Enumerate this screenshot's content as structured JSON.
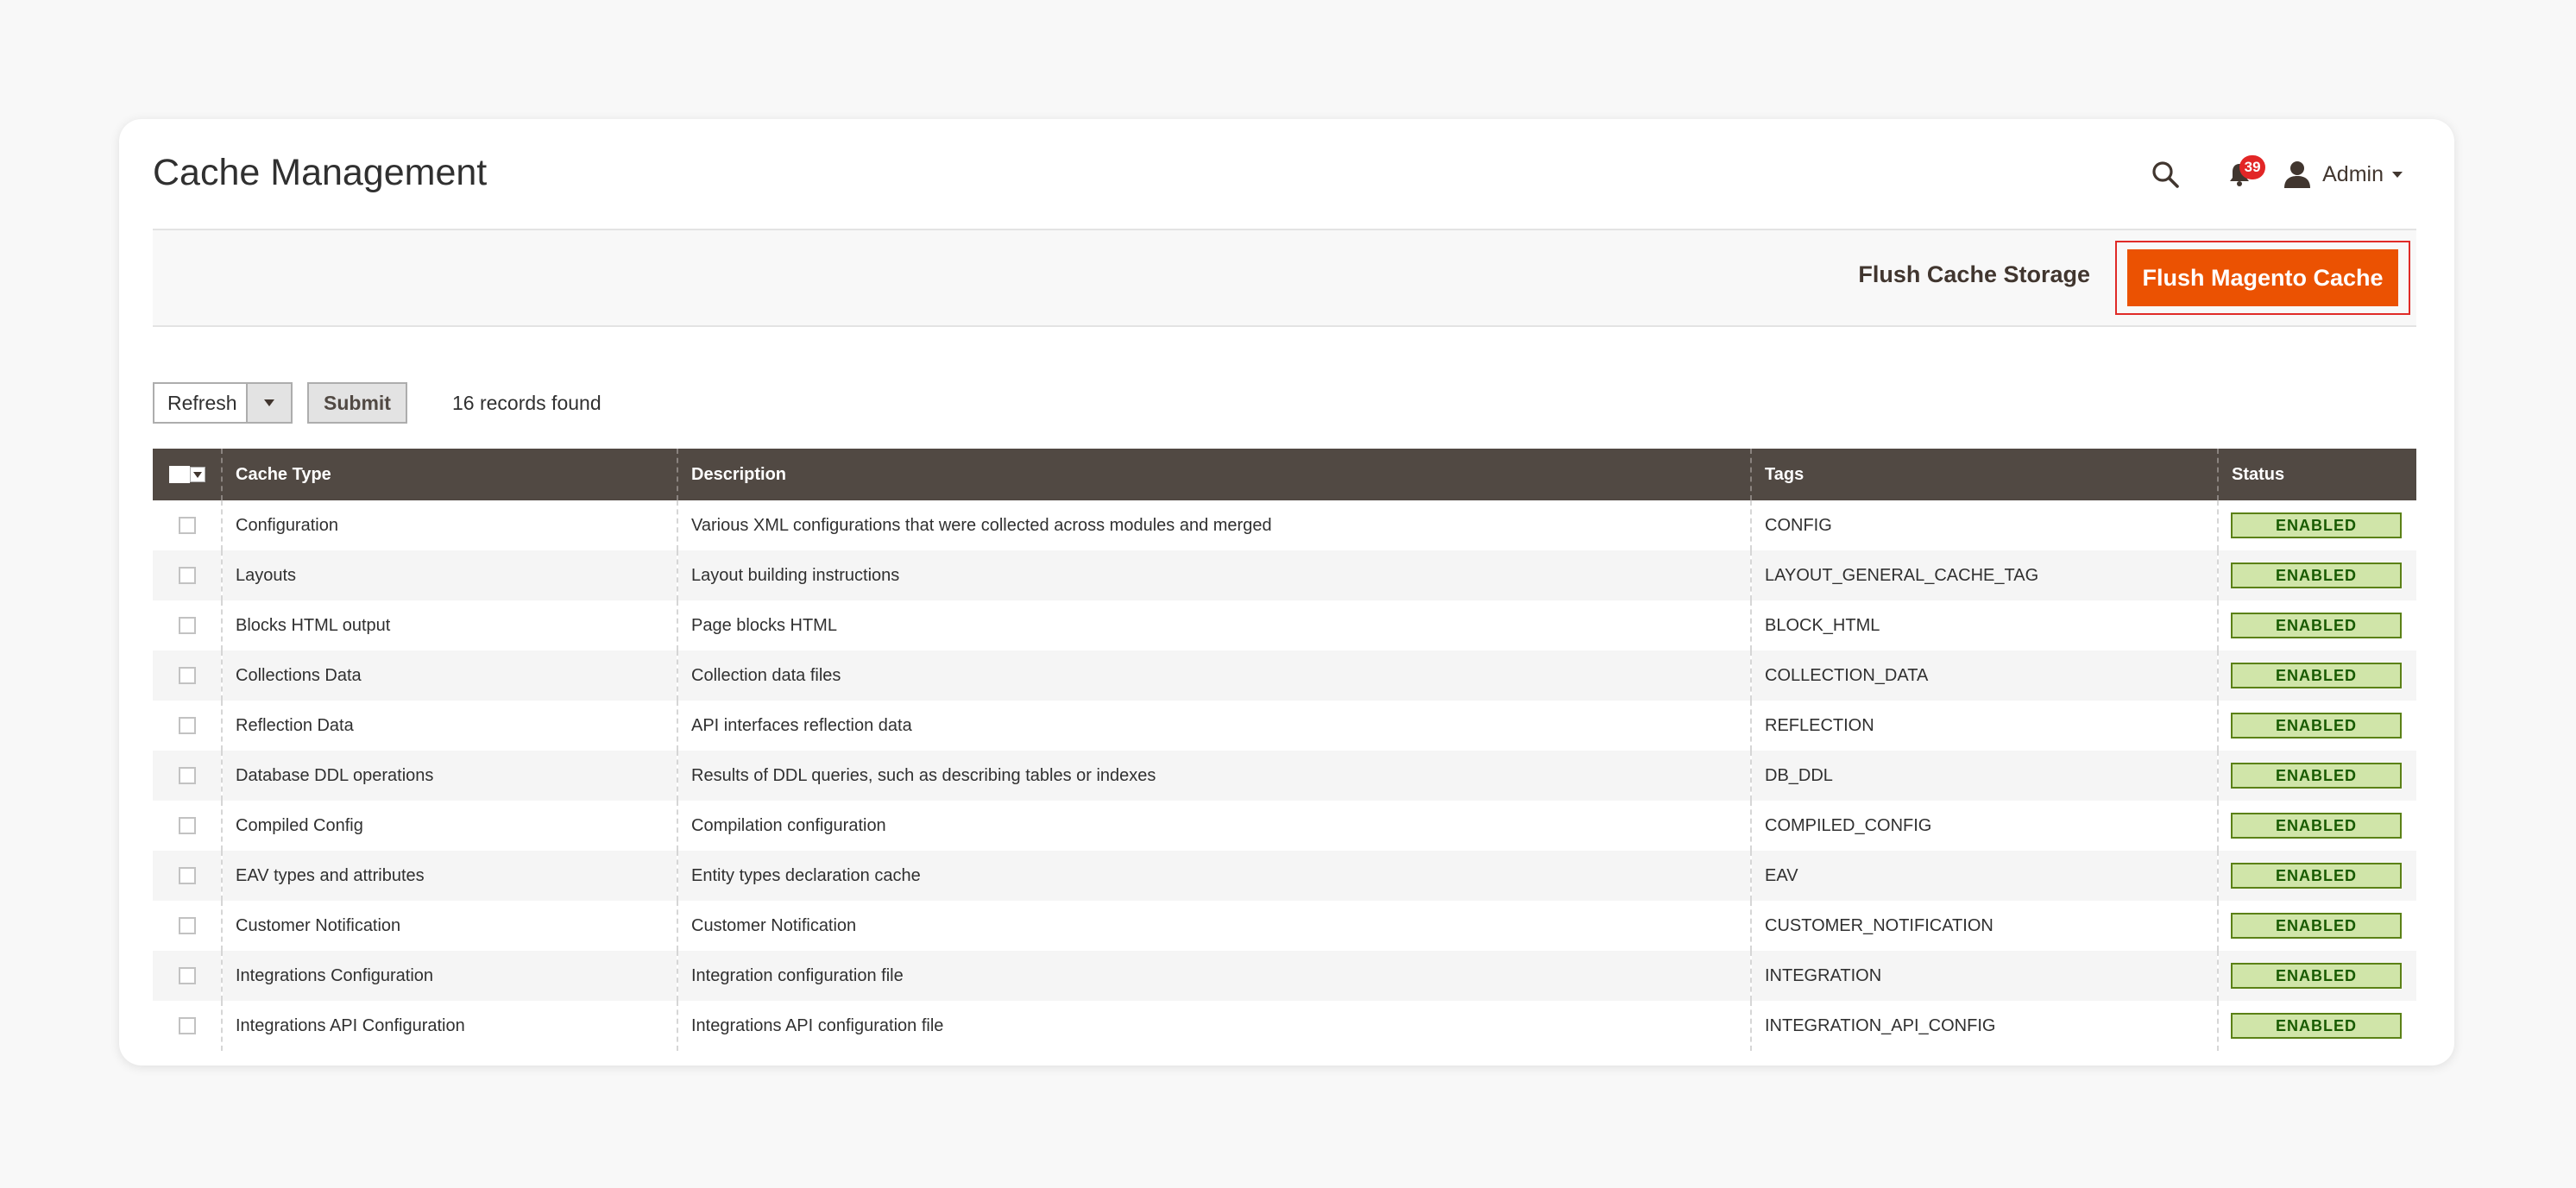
{
  "page": {
    "title": "Cache Management"
  },
  "header": {
    "notifications_count": "39",
    "user_name": "Admin"
  },
  "actions": {
    "flush_storage_label": "Flush Cache Storage",
    "flush_magento_label": "Flush Magento Cache"
  },
  "toolbar": {
    "mass_action_value": "Refresh",
    "submit_label": "Submit",
    "records_found": "16 records found"
  },
  "grid": {
    "columns": {
      "cache_type": "Cache Type",
      "description": "Description",
      "tags": "Tags",
      "status": "Status"
    },
    "rows": [
      {
        "type": "Configuration",
        "description": "Various XML configurations that were collected across modules and merged",
        "tags": "CONFIG",
        "status": "ENABLED"
      },
      {
        "type": "Layouts",
        "description": "Layout building instructions",
        "tags": "LAYOUT_GENERAL_CACHE_TAG",
        "status": "ENABLED"
      },
      {
        "type": "Blocks HTML output",
        "description": "Page blocks HTML",
        "tags": "BLOCK_HTML",
        "status": "ENABLED"
      },
      {
        "type": "Collections Data",
        "description": "Collection data files",
        "tags": "COLLECTION_DATA",
        "status": "ENABLED"
      },
      {
        "type": "Reflection Data",
        "description": "API interfaces reflection data",
        "tags": "REFLECTION",
        "status": "ENABLED"
      },
      {
        "type": "Database DDL operations",
        "description": "Results of DDL queries, such as describing tables or indexes",
        "tags": "DB_DDL",
        "status": "ENABLED"
      },
      {
        "type": "Compiled Config",
        "description": "Compilation configuration",
        "tags": "COMPILED_CONFIG",
        "status": "ENABLED"
      },
      {
        "type": "EAV types and attributes",
        "description": "Entity types declaration cache",
        "tags": "EAV",
        "status": "ENABLED"
      },
      {
        "type": "Customer Notification",
        "description": "Customer Notification",
        "tags": "CUSTOMER_NOTIFICATION",
        "status": "ENABLED"
      },
      {
        "type": "Integrations Configuration",
        "description": "Integration configuration file",
        "tags": "INTEGRATION",
        "status": "ENABLED"
      },
      {
        "type": "Integrations API Configuration",
        "description": "Integrations API configuration file",
        "tags": "INTEGRATION_API_CONFIG",
        "status": "ENABLED"
      }
    ]
  },
  "colors": {
    "accent": "#eb5202",
    "header_bg": "#514943",
    "enabled_bg": "#d0e5a9",
    "enabled_border": "#5b8116",
    "enabled_text": "#185b00",
    "highlight_border": "#e02b27",
    "badge": "#e22626"
  },
  "icons": {
    "search": "search-icon",
    "notifications": "bell-icon",
    "user": "user-icon",
    "dropdown": "chevron-down-icon"
  }
}
